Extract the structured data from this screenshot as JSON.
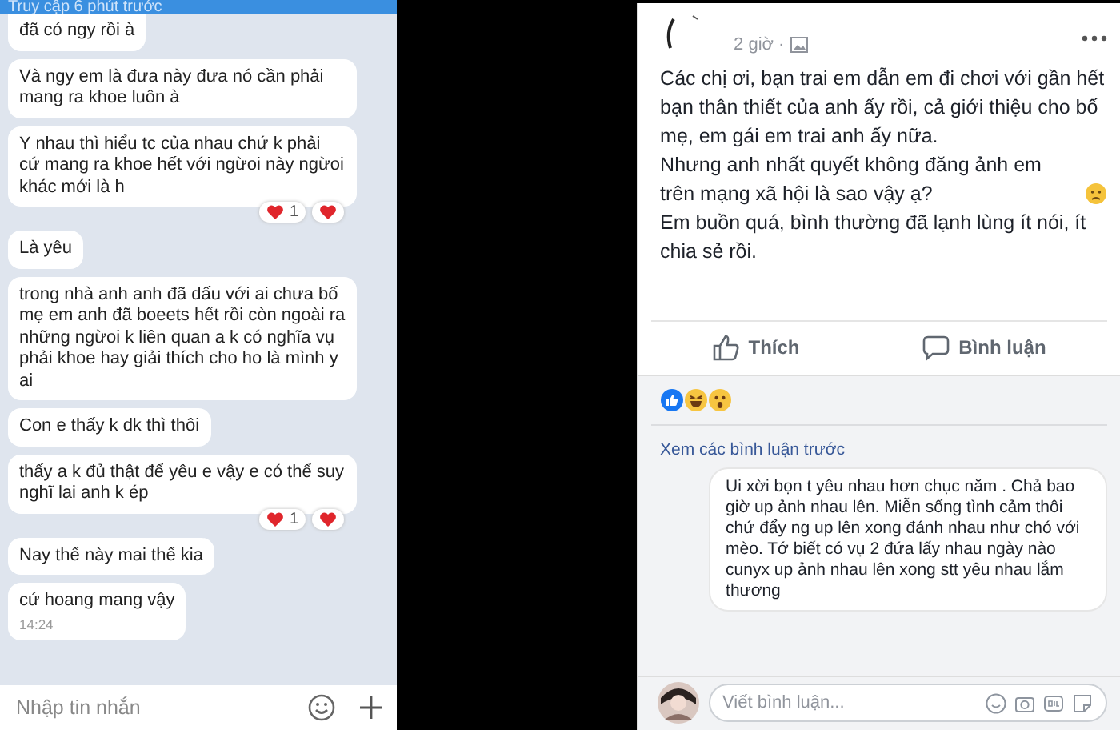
{
  "chat": {
    "status": "Truy cập 6 phút trước",
    "messages": [
      {
        "text": "đã có ngy rồi à"
      },
      {
        "text": "Và ngy em là đưa này đưa nó cần phải mang ra khoe luôn à"
      },
      {
        "text": "Y nhau thì hiểu tc của nhau chứ k phải cứ mang ra khoe hết với ngừoi này ngừoi khác mới là h",
        "reaction": {
          "count": "1"
        }
      },
      {
        "text": "Là yêu"
      },
      {
        "text": "trong nhà anh anh đã dấu với ai chưa bố mẹ em anh đã boeets hết rồi còn ngoài ra những ngừoi k liên quan a k có nghĩa vụ phải khoe hay giải thích cho ho là mình y ai"
      },
      {
        "text": "Con e thấy k dk thì thôi"
      },
      {
        "text": "thấy a k đủ thật để yêu e vậy e có thể suy nghĩ lai anh k ép",
        "reaction": {
          "count": "1"
        }
      },
      {
        "text": "Nay thế này mai thế kia"
      },
      {
        "text": "cứ hoang mang vậy",
        "time": "14:24"
      }
    ],
    "input": {
      "placeholder": "Nhập tin nhắn"
    }
  },
  "post": {
    "time": "2 giờ ·",
    "paragraphs": [
      {
        "text": "Các chị ơi, bạn trai em dẫn em đi chơi với gần hết bạn thân thiết của anh ấy rồi, cả giới thiệu cho bố mẹ, em gái em trai anh ấy nữa.",
        "emoji": false
      },
      {
        "text": "Nhưng anh nhất quyết không đăng ảnh em trên mạng xã hội là sao vậy ạ?",
        "emoji": true
      },
      {
        "text": "Em buồn quá, bình thường đã lạnh lùng ít nói, ít chia sẻ rồi.",
        "emoji": false
      }
    ],
    "actions": [
      {
        "kind": "like",
        "label": "Thích"
      },
      {
        "kind": "comment",
        "label": "Bình luận"
      }
    ],
    "previous_comments": "Xem các bình luận trước",
    "comments": [
      {
        "text": "Ui xời bọn t yêu nhau hơn chục năm . Chả bao giờ up ảnh nhau lên. Miễn sống tình cảm thôi chứ đẩy ng up lên xong đánh nhau như chó với mèo. Tớ biết có vụ 2 đứa lấy nhau ngày nào cunyx up ảnh nhau lên xong stt yêu nhau lắm thương"
      }
    ],
    "comment_input": {
      "placeholder": "Viết bình luận..."
    }
  }
}
